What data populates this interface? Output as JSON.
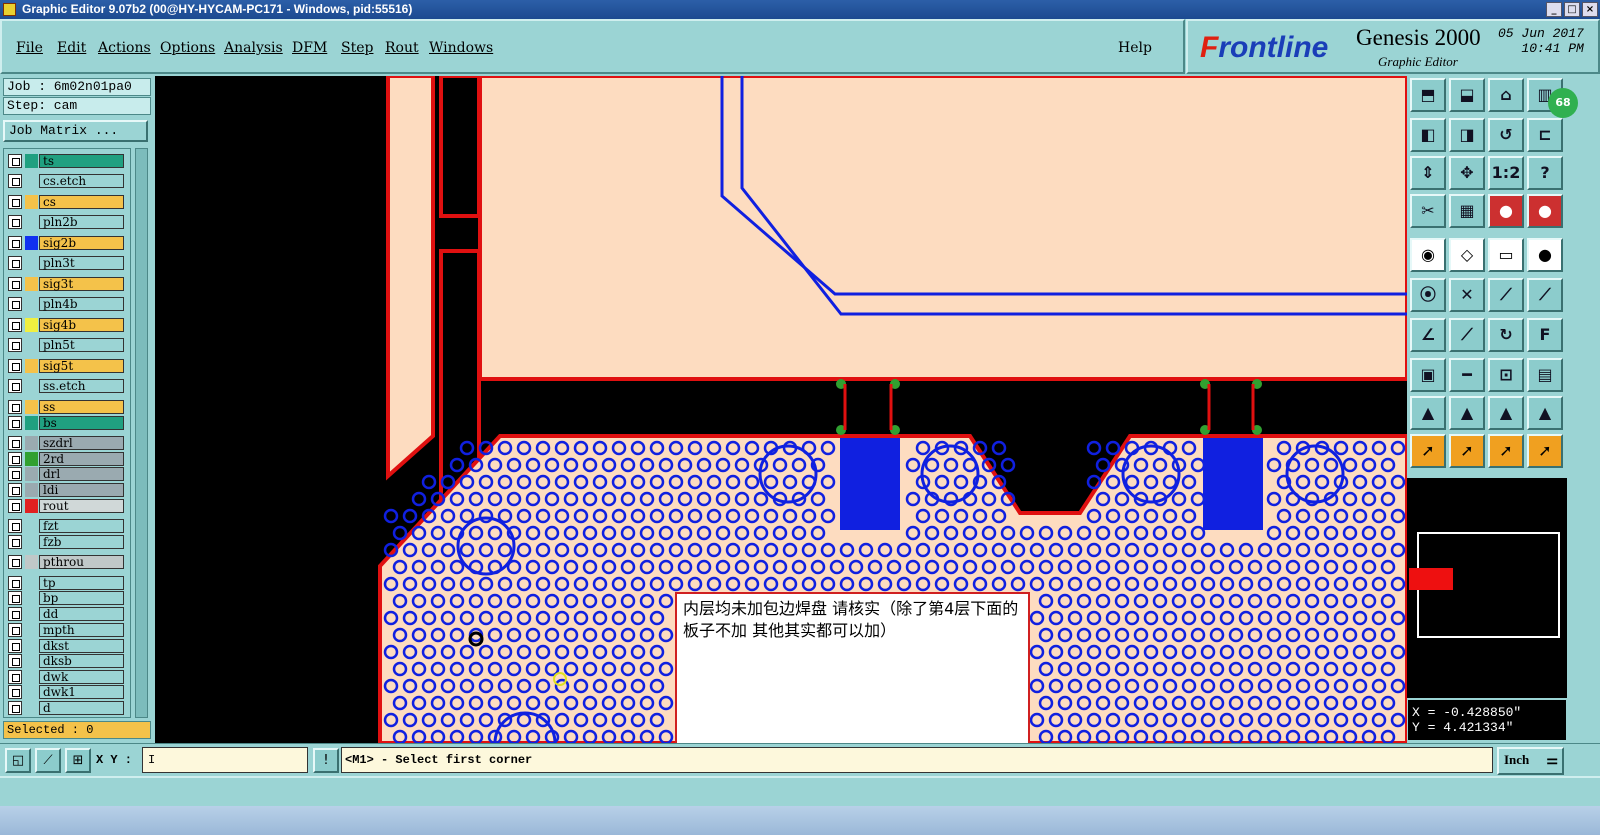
{
  "window": {
    "title": "Graphic Editor 9.07b2 (00@HY-HYCAM-PC171 - Windows, pid:55516)"
  },
  "menu": {
    "items": [
      "File",
      "Edit",
      "Actions",
      "Options",
      "Analysis",
      "DFM",
      "Step",
      "Rout",
      "Windows"
    ],
    "help": "Help"
  },
  "brand": {
    "logo_prefix": "F",
    "logo_rest": "rontline",
    "product": "Genesis 2000",
    "subtitle": "Graphic Editor",
    "date": "05 Jun 2017",
    "time": "10:41 PM"
  },
  "job": {
    "job": "Job : 6m02n01pa0",
    "step": "Step: cam",
    "matrix_button": "Job Matrix ..."
  },
  "layers": [
    {
      "name": "ts",
      "color": "#20a080",
      "swatch": "#20a080"
    },
    {
      "name": "cs.etch",
      "color": "#9bd4d4",
      "swatch": "#9bd4d4"
    },
    {
      "name": "cs",
      "color": "#f4c24a",
      "swatch": "#f4c24a"
    },
    {
      "name": "pln2b",
      "color": "#9bd4d4",
      "swatch": "#9bd4d4"
    },
    {
      "name": "sig2b",
      "color": "#f4c24a",
      "swatch": "#1030f0"
    },
    {
      "name": "pln3t",
      "color": "#9bd4d4",
      "swatch": "#9bd4d4"
    },
    {
      "name": "sig3t",
      "color": "#f4c24a",
      "swatch": "#f4c24a"
    },
    {
      "name": "pln4b",
      "color": "#9bd4d4",
      "swatch": "#9bd4d4"
    },
    {
      "name": "sig4b",
      "color": "#f4c24a",
      "swatch": "#f0f040"
    },
    {
      "name": "pln5t",
      "color": "#9bd4d4",
      "swatch": "#9bd4d4"
    },
    {
      "name": "sig5t",
      "color": "#f4c24a",
      "swatch": "#f4c24a"
    },
    {
      "name": "ss.etch",
      "color": "#9bd4d4",
      "swatch": "#9bd4d4"
    },
    {
      "name": "ss",
      "color": "#f4c24a",
      "swatch": "#f4c24a"
    },
    {
      "name": "bs",
      "color": "#20a080",
      "swatch": "#20a080"
    },
    {
      "name": "szdrl",
      "color": "#9aaab0",
      "swatch": "#9aaab0"
    },
    {
      "name": "2rd",
      "color": "#9aaab0",
      "swatch": "#30a030"
    },
    {
      "name": "drl",
      "color": "#9aaab0",
      "swatch": "#9aaab0"
    },
    {
      "name": "ldi",
      "color": "#9aaab0",
      "swatch": "#9aaab0"
    },
    {
      "name": "rout",
      "color": "#d0d8d8",
      "swatch": "#e02020"
    },
    {
      "name": "fzt",
      "color": "#9bd4d4",
      "swatch": "#9bd4d4"
    },
    {
      "name": "fzb",
      "color": "#9bd4d4",
      "swatch": "#9bd4d4"
    },
    {
      "name": "pthrou",
      "color": "#c0c8c8",
      "swatch": "#c0c8c8"
    },
    {
      "name": "tp",
      "color": "#9bd4d4",
      "swatch": "#9bd4d4"
    },
    {
      "name": "bp",
      "color": "#9bd4d4",
      "swatch": "#9bd4d4"
    },
    {
      "name": "dd",
      "color": "#9bd4d4",
      "swatch": "#9bd4d4"
    },
    {
      "name": "mpth",
      "color": "#9bd4d4",
      "swatch": "#9bd4d4"
    },
    {
      "name": "dkst",
      "color": "#9bd4d4",
      "swatch": "#9bd4d4"
    },
    {
      "name": "dksb",
      "color": "#9bd4d4",
      "swatch": "#9bd4d4"
    },
    {
      "name": "dwk",
      "color": "#9bd4d4",
      "swatch": "#9bd4d4"
    },
    {
      "name": "dwk1",
      "color": "#9bd4d4",
      "swatch": "#9bd4d4"
    },
    {
      "name": "d",
      "color": "#9bd4d4",
      "swatch": "#9bd4d4"
    }
  ],
  "selected": "Selected : 0",
  "annotation": {
    "text": "内层均未加包边焊盘 请核实（除了第4层下面的板子不加 其他其实都可以加）"
  },
  "coords": {
    "x": "X = -0.428850\"",
    "y": "Y = 4.421334\""
  },
  "bottom": {
    "xy_label": "X Y :",
    "xy_value": "I",
    "prompt": "<M1> - Select first corner",
    "unit": "Inch"
  },
  "badge": "68",
  "colors": {
    "board": "#fddcc0",
    "copper": "#1020e0",
    "rout": "#e01010",
    "pad_green": "#30a030"
  }
}
